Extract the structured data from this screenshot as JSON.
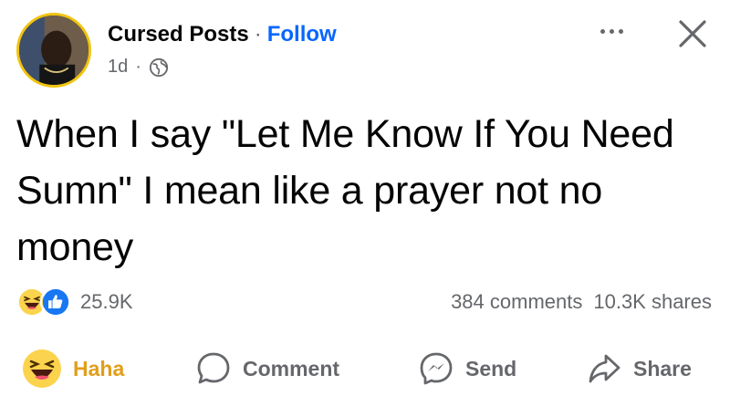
{
  "post": {
    "page_name": "Cursed Posts",
    "separator": "·",
    "follow_label": "Follow",
    "time": "1d",
    "meta_separator": "·",
    "privacy_icon": "globe-icon",
    "text": "When I say \"Let Me Know If You Need Sumn\" I mean like a prayer not no money"
  },
  "stats": {
    "reaction_icons": [
      "haha-reaction-icon",
      "like-reaction-icon"
    ],
    "reaction_count": "25.9K",
    "comments": "384 comments",
    "shares": "10.3K shares"
  },
  "actions": {
    "haha_label": "Haha",
    "comment_label": "Comment",
    "send_label": "Send",
    "share_label": "Share"
  },
  "colors": {
    "follow": "#0866ff",
    "haha_text": "#e29d1a",
    "secondary_text": "#65676b",
    "like_blue": "#1877f2",
    "haha_yellow": "#fcd34d"
  }
}
